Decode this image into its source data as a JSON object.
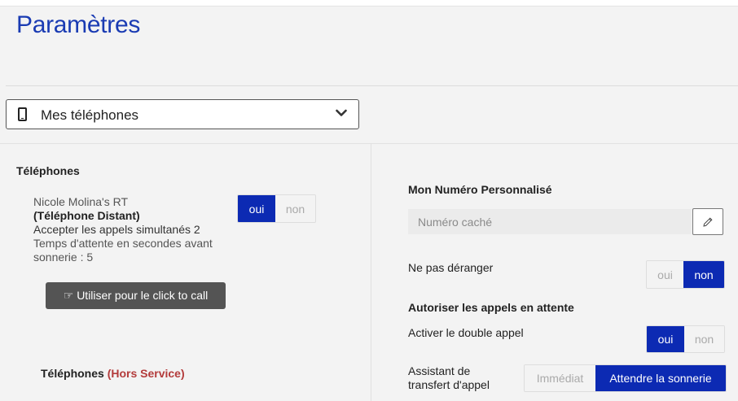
{
  "page": {
    "title": "Paramètres"
  },
  "selector": {
    "label": "Mes téléphones",
    "icon": "mobile-phone-icon",
    "chevron": "chevron-down-icon"
  },
  "left": {
    "section_title": "Téléphones",
    "device": {
      "name": "Nicole Molina's RT",
      "type": "(Téléphone Distant)",
      "simultaneous": "Accepter les appels simultanés 2",
      "wait_line1": "Temps d'attente en secondes avant",
      "wait_line2": "sonnerie : 5",
      "toggle": {
        "yes": "oui",
        "no": "non",
        "selected": "oui"
      }
    },
    "click_to_call": "☞ Utiliser pour le click to call",
    "out_of_service_title": "Téléphones ",
    "out_of_service_tag": "(Hors Service)"
  },
  "right": {
    "custom_number_title": "Mon Numéro Personnalisé",
    "custom_number_placeholder": "Numéro caché",
    "dnd_label": "Ne pas déranger",
    "dnd_toggle": {
      "yes": "oui",
      "no": "non",
      "selected": "non"
    },
    "waiting_title": "Autoriser les appels en attente",
    "double_call_label": "Activer le double appel",
    "double_call_toggle": {
      "yes": "oui",
      "no": "non",
      "selected": "oui"
    },
    "transfer_label_line1": "Assistant de",
    "transfer_label_line2": "transfert d'appel",
    "transfer_options": {
      "immediate": "Immédiat",
      "wait": "Attendre la sonnerie",
      "selected": "Attendre la sonnerie"
    }
  },
  "colors": {
    "accent": "#0c2ab3",
    "title": "#1a3bb3",
    "out_of_service": "#b33b3b",
    "dark_button": "#545454"
  }
}
